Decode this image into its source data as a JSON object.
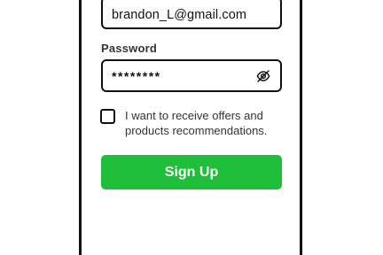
{
  "form": {
    "email_value": "brandon_L@gmail.com",
    "password_label": "Password",
    "password_value": "********",
    "offers_checkbox_label": "I want to receive offers and products recommendations.",
    "offers_checked": false,
    "signup_label": "Sign Up"
  },
  "icons": {
    "password_toggle": "eye-slash-icon"
  },
  "colors": {
    "primary_button": "#1fbf3b",
    "border": "#111111",
    "label_text": "#333333"
  }
}
